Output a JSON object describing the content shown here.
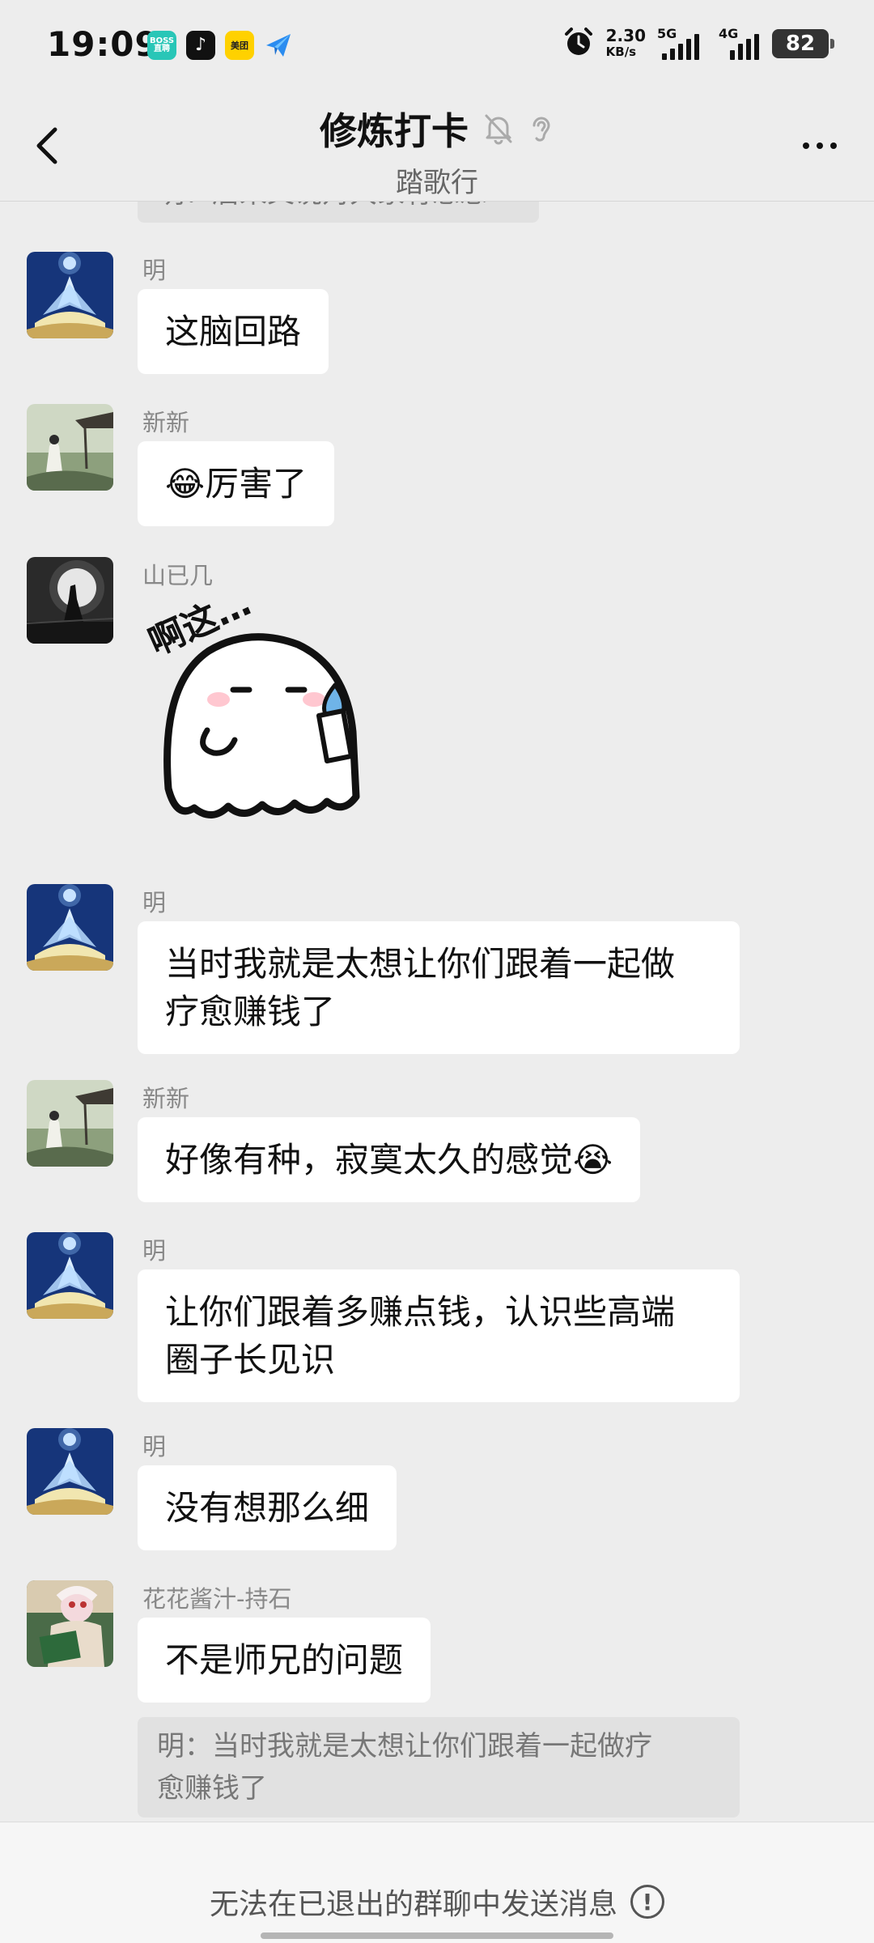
{
  "status_bar": {
    "time": "19:09",
    "apps": [
      "BOSS直聘",
      "♪",
      "美团",
      ""
    ],
    "net_speed": "2.30",
    "net_unit": "KB/s",
    "sim1": "5G",
    "sim2": "4G",
    "battery": "82"
  },
  "header": {
    "title": "修炼打卡",
    "subtitle": "踏歌行",
    "icons": [
      "back-arrow-icon",
      "mute-bell-icon",
      "ear-icon",
      "more-icon"
    ]
  },
  "cut_off_quote": "明：后来又说对大家有思想",
  "messages": [
    {
      "sender": "明",
      "text": "这脑回路",
      "avatar": "lotus"
    },
    {
      "sender": "新新",
      "text": "😂厉害了",
      "avatar": "landscape"
    },
    {
      "sender": "山已几",
      "text": "",
      "sticker_text": "啊这…",
      "avatar": "moon"
    },
    {
      "sender": "明",
      "text_lines": [
        "当时我就是太想让你们跟着一起做",
        "疗愈赚钱了"
      ],
      "avatar": "lotus"
    },
    {
      "sender": "新新",
      "text": "好像有种，寂寞太久的感觉😭",
      "avatar": "landscape"
    },
    {
      "sender": "明",
      "text_lines": [
        "让你们跟着多赚点钱，认识些高端",
        "圈子长见识"
      ],
      "avatar": "lotus"
    },
    {
      "sender": "明",
      "text": "没有想那么细",
      "avatar": "lotus"
    },
    {
      "sender": "花花酱汁-持石",
      "text": "不是师兄的问题",
      "avatar": "reader",
      "quote_lines": [
        "明：当时我就是太想让你们跟着一起做疗",
        "愈赚钱了"
      ]
    }
  ],
  "bottom": {
    "notice": "无法在已退出的群聊中发送消息",
    "info_glyph": "!"
  }
}
